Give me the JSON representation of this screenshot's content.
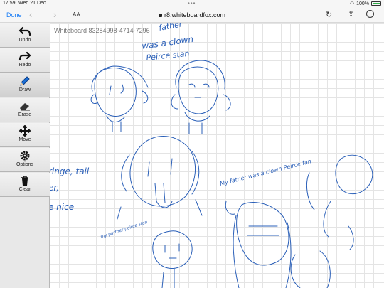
{
  "status_bar": {
    "time": "17:59",
    "date": "Wed 21 Dec",
    "battery": "100%"
  },
  "browser": {
    "done_label": "Done",
    "text_size_label": "AA",
    "url": "r8.whiteboardfox.com"
  },
  "toolbar": {
    "tools": [
      {
        "label": "Undo",
        "icon": "undo-icon",
        "active": false
      },
      {
        "label": "Redo",
        "icon": "redo-icon",
        "active": false
      },
      {
        "label": "Draw",
        "icon": "pencil-icon",
        "active": true
      },
      {
        "label": "Erase",
        "icon": "eraser-icon",
        "active": false
      },
      {
        "label": "Move",
        "icon": "move-icon",
        "active": false
      },
      {
        "label": "Options",
        "icon": "gear-icon",
        "active": false
      },
      {
        "label": "Clear",
        "icon": "trash-icon",
        "active": false
      }
    ]
  },
  "board": {
    "title": "Whiteboard 83284998-4714-7296",
    "ink_color": "#2a5fb8",
    "handwriting": [
      "father",
      "was a clown",
      "Peirce stan",
      "ringe, tail",
      "er,",
      "e nice",
      "My father was a clown Peirce fan",
      "my partner peirce stan"
    ]
  }
}
